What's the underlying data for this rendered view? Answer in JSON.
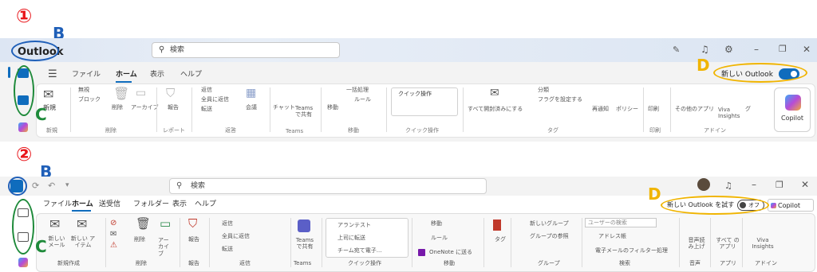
{
  "annotations": {
    "marker1": "①",
    "marker2": "②",
    "b1": "B",
    "b2": "B",
    "c1": "C",
    "c2": "C",
    "d1": "D",
    "d2": "D"
  },
  "p1": {
    "title": "Outlook",
    "search_placeholder": "検索",
    "menu": [
      "ファイル",
      "ホーム",
      "表示",
      "ヘルプ"
    ],
    "new_outlook_label": "新しい Outlook",
    "new_btn": "新規",
    "delete_group": {
      "block": "ブロック",
      "delete": "削除",
      "archive": "アーカイブ",
      "ignore": "無視"
    },
    "report": "報告",
    "reply": {
      "reply": "返信",
      "reply_all": "全員に返信",
      "forward": "転送",
      "meeting": "会議"
    },
    "teams": {
      "chat": "チャット",
      "share": "Teams で共有"
    },
    "move": {
      "move": "移動",
      "rules": "ルール",
      "one_click": "一括処理"
    },
    "quick_steps": "クイック操作",
    "mark_read": "すべて開封済みにする",
    "categorize": "分類",
    "flag": "フラグを設定する",
    "snooze": "再通知",
    "policy": "ポリシー",
    "print": "印刷",
    "other_apps": "その他のアプリ",
    "viva": "Viva Insights",
    "gr": "グ",
    "copilot": "Copilot",
    "group_labels": [
      "新規",
      "削除",
      "レポート",
      "返答",
      "Teams",
      "移動",
      "クイック操作",
      "タグ",
      "印刷",
      "アドイン"
    ]
  },
  "p2": {
    "search_placeholder": "検索",
    "menu": [
      "ファイル",
      "ホーム",
      "送受信",
      "フォルダー",
      "表示",
      "ヘルプ"
    ],
    "try_new_outlook": "新しい Outlook を試す",
    "toggle_off": "オフ",
    "copilot": "Copilot",
    "new_mail": "新しい メール",
    "new_items": "新しい アイテム",
    "delete": "削除",
    "archive": "アーカイブ",
    "report": "報告",
    "reply": "返信",
    "reply_all": "全員に返信",
    "forward": "転送",
    "teams_share": "Teams で共有",
    "quick": [
      "アランテスト",
      "上司に転送",
      "チーム宛て電子..."
    ],
    "move": "移動",
    "rules": "ルール",
    "onenote": "OneNote に送る",
    "tag": "タグ",
    "new_group": "新しいグループ",
    "browse_groups": "グループの参照",
    "user_search": "ユーザーの検索",
    "address_book": "アドレス帳",
    "filter_email": "電子メールのフィルター処理",
    "read_aloud": "音声読み上げ",
    "all_apps": "すべて のアプリ",
    "viva": "Viva Insights",
    "group_labels": [
      "新規作成",
      "削除",
      "報告",
      "返信",
      "Teams",
      "クイック操作",
      "移動",
      "グループ",
      "検索",
      "音声",
      "アプリ",
      "アドイン"
    ]
  },
  "colors": {
    "red": "#e8161b",
    "blue": "#1f5fb8",
    "green": "#1e8a3a",
    "yellow": "#f0b400",
    "accent": "#0f6cbd"
  }
}
